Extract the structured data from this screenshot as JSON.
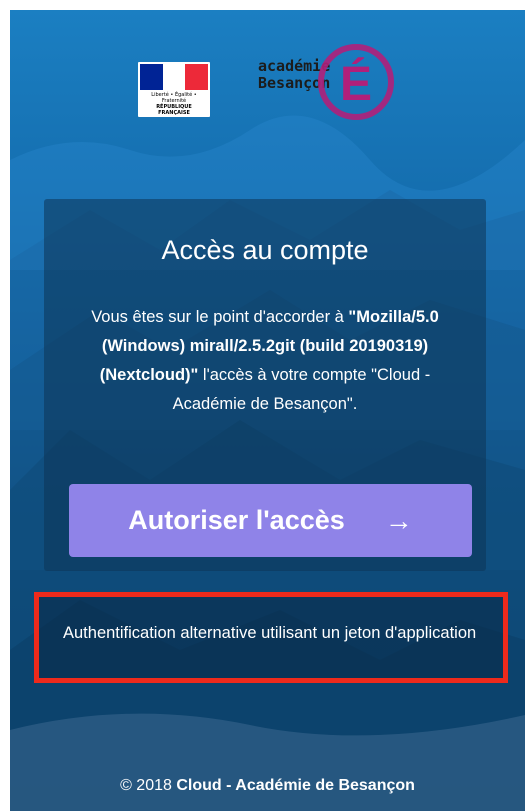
{
  "logos": {
    "republique_francaise": {
      "flag_colors": [
        "#002395",
        "#ffffff",
        "#ed2939"
      ],
      "caption_line1": "Liberté • Égalité • Fraternité",
      "caption_line2": "RÉPUBLIQUE FRANÇAISE"
    },
    "academie": {
      "line1": "académie",
      "line2": "Besançon",
      "letter": "É",
      "color": "#b0207a"
    }
  },
  "card": {
    "title": "Accès au compte",
    "text_before": "Vous êtes sur le point d'accorder à ",
    "client_name": "\"Mozilla/5.0 (Windows) mirall/2.5.2git (build 20190319) (Nextcloud)\"",
    "text_middle": " l'accès à votre compte ",
    "account_name": "\"Cloud - Académie de Besançon\".",
    "authorize_button": "Autoriser l'accès",
    "authorize_arrow": "→"
  },
  "alternative": {
    "link_text": "Authentification alternative utilisant un jeton d'application",
    "highlight_color": "#ee2a1c"
  },
  "footer": {
    "copyright": "© 2018 ",
    "site_name": "Cloud - Académie de Besançon"
  },
  "colors": {
    "button": "#8f83e8",
    "background": "#156fb0"
  }
}
